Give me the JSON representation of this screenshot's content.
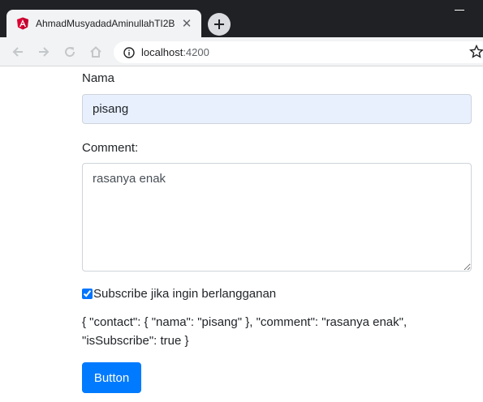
{
  "browser": {
    "tab_title": "AhmadMusyadadAminullahTI2B",
    "tab_favicon": "angular-icon",
    "url_host": "localhost",
    "url_port": ":4200"
  },
  "form": {
    "nama_label": "Nama",
    "nama_value": "pisang",
    "comment_label": "Comment:",
    "comment_value": "rasanya enak",
    "subscribe_label": "Subscribe jika ingin berlangganan",
    "subscribe_checked": true,
    "json_output": "{ \"contact\": { \"nama\": \"pisang\" }, \"comment\": \"rasanya enak\", \"isSubscribe\": true }",
    "button_label": "Button"
  },
  "colors": {
    "primary": "#007bff",
    "autofill": "#e8f0fe",
    "angular": "#dd0031"
  }
}
